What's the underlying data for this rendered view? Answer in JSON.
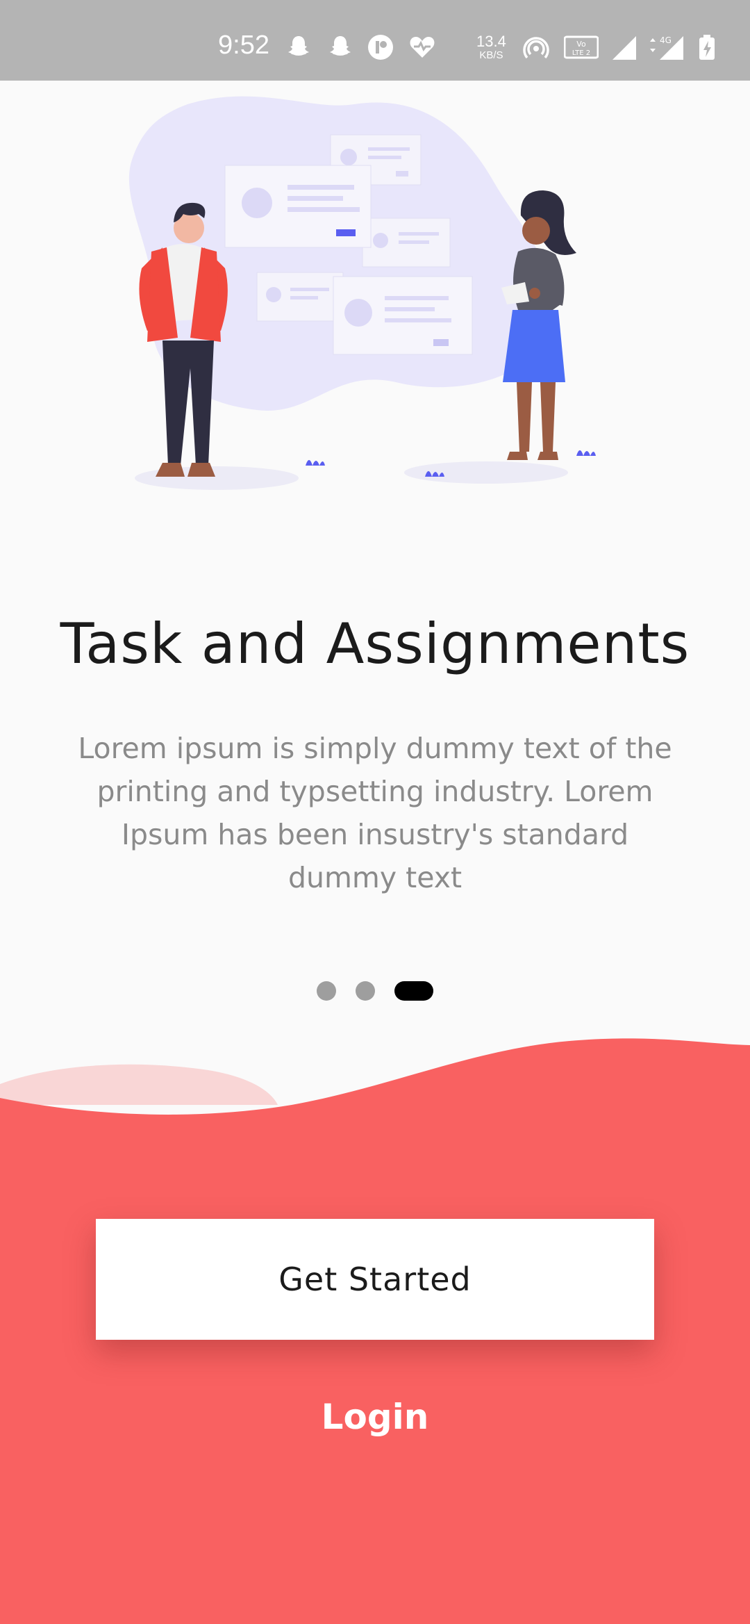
{
  "status_bar": {
    "time": "9:52",
    "net_speed_value": "13.4",
    "net_speed_unit": "KB/S",
    "volte_label": "Vo LTE 2",
    "network_label": "4G",
    "icons": [
      "snapchat-icon",
      "snapchat-icon",
      "app-icon",
      "heart-icon",
      "hotspot-icon",
      "volte-icon",
      "signal-icon",
      "signal-4g-icon",
      "battery-charging-icon"
    ]
  },
  "onboarding": {
    "title": "Task and Assignments",
    "description": "Lorem ipsum is simply dummy text of the printing and typsetting industry. Lorem Ipsum has been insustry's standard dummy text",
    "page_indicator": {
      "total": 3,
      "current": 3
    }
  },
  "actions": {
    "get_started_label": "Get Started",
    "login_label": "Login"
  },
  "colors": {
    "accent": "#f96161",
    "accent_light": "#f9d6d6",
    "illustration_blob": "#e8e6fb",
    "illustration_accent": "#5a5ef0",
    "status_bar": "#b4b4b4"
  }
}
